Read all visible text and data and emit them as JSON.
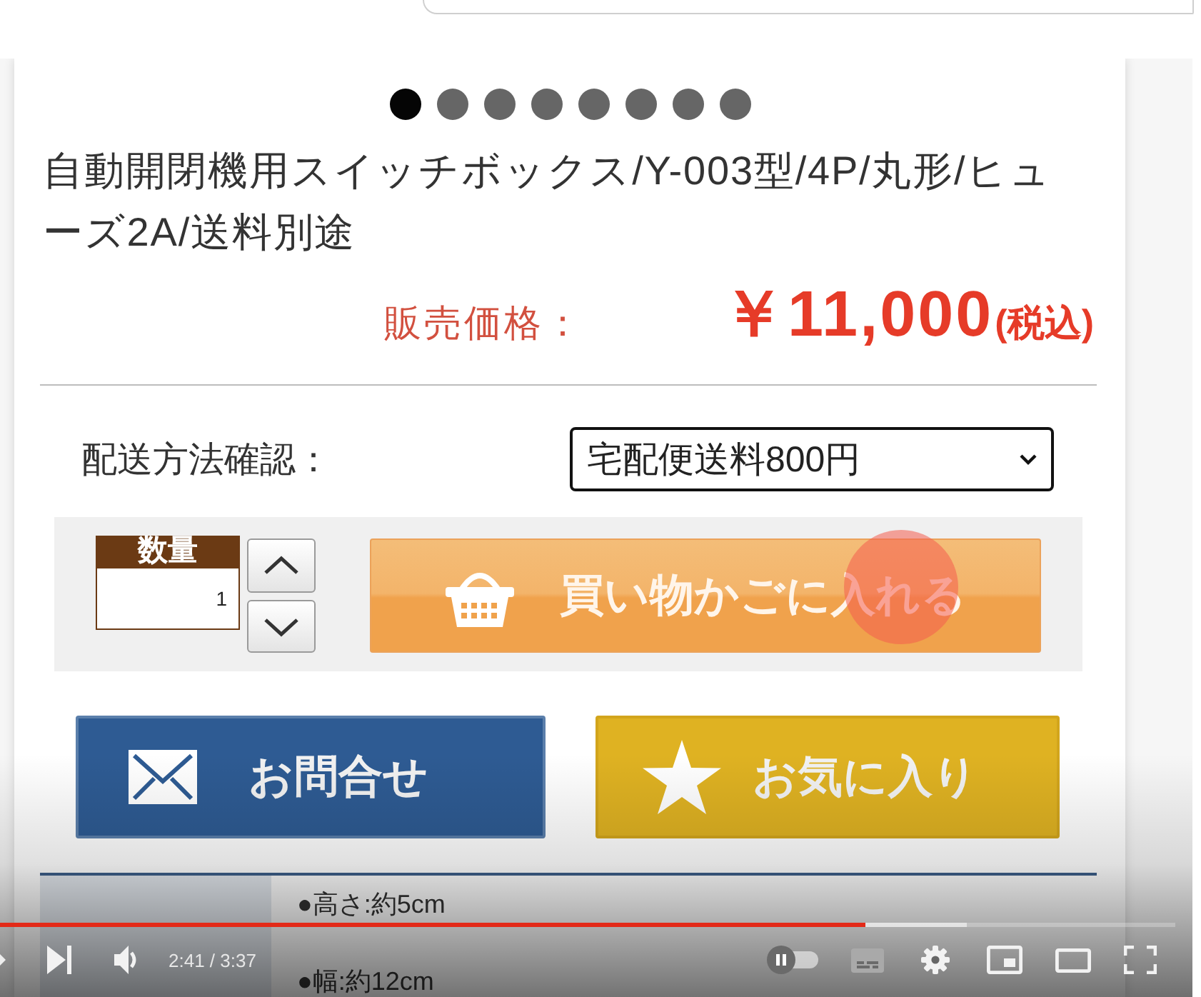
{
  "product": {
    "image_dots": [
      {
        "selected": true
      },
      {
        "selected": false
      },
      {
        "selected": false
      },
      {
        "selected": false
      },
      {
        "selected": false
      },
      {
        "selected": false
      },
      {
        "selected": false
      },
      {
        "selected": false
      }
    ],
    "title": "自動開閉機用スイッチボックス/Y-003型/4P/丸形/ヒューズ2A/送料別途",
    "price": {
      "label": "販売価格：",
      "amount": "￥11,000",
      "tax_note": "(税込)"
    },
    "shipping": {
      "label": "配送方法確認：",
      "value": "宅配便送料800円"
    },
    "quantity": {
      "label": "数量",
      "value": "1"
    },
    "cart_button": {
      "label": "買い物かごに入れる",
      "click_marker": true
    },
    "buttons": [
      {
        "kind": "contact",
        "label": "お問合せ"
      },
      {
        "kind": "favorite",
        "label": "お気に入り"
      }
    ],
    "specs": [
      "●高さ:約5cm",
      "●幅:約12cm"
    ]
  },
  "player": {
    "progress": {
      "level": 0.736
    },
    "buffer": {
      "level": 0.822
    },
    "time": "2:41 / 3:37",
    "autoplay": {
      "on": false
    }
  }
}
